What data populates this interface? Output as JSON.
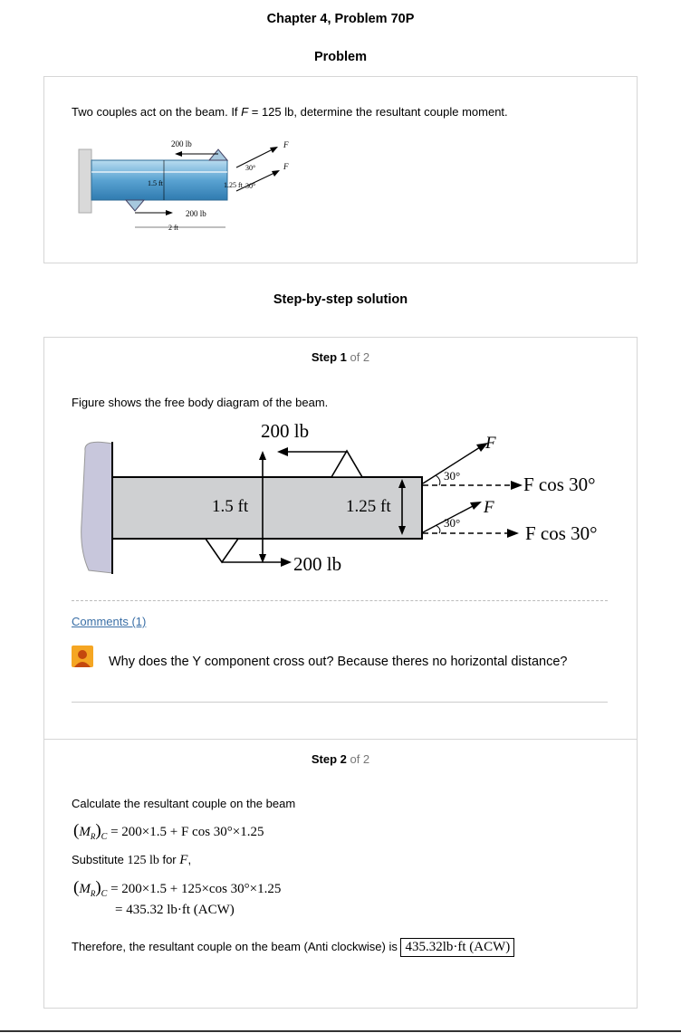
{
  "title": "Chapter 4, Problem 70P",
  "problem_heading": "Problem",
  "problem_text_before": "Two couples act on the beam. If ",
  "problem_var": "F",
  "problem_text_after": " = 125 lb, determine the resultant couple moment.",
  "problem_figure": {
    "force_top": "200 lb",
    "force_bottom": "200 lb",
    "dim_a": "1.5 ft",
    "dim_b": "1.25 ft",
    "dim_c": "2 ft",
    "angle_top": "30°",
    "angle_bottom": "30°",
    "force_f_top": "F",
    "force_f_bottom": "F"
  },
  "solution_heading": "Step-by-step solution",
  "step1": {
    "label": "Step 1",
    "of": " of 2",
    "text": "Figure shows the free body diagram of the beam.",
    "figure": {
      "force_top": "200 lb",
      "force_bottom": "200 lb",
      "dim_a": "1.5 ft",
      "dim_b": "1.25 ft",
      "angle_top": "30°",
      "angle_bottom": "30°",
      "f_top": "F",
      "f_mid": "F",
      "fcos_top": "F cos 30°",
      "fcos_bottom": "F cos 30°"
    }
  },
  "comments": {
    "link": "Comments (1)",
    "items": [
      {
        "text": "Why does the Y component cross out? Because theres no horizontal distance?"
      }
    ]
  },
  "step2": {
    "label": "Step 2",
    "of": " of 2",
    "text1": "Calculate the resultant couple on the beam",
    "eq1_rhs": "= 200×1.5 + F cos 30°×1.25",
    "substitute_word": "Substitute",
    "substitute_value": "125 lb",
    "substitute_for": "for",
    "substitute_var": "F",
    "substitute_comma": ",",
    "eq2_rhs": "= 200×1.5 + 125×cos 30°×1.25",
    "eq3": "= 435.32 lb·ft (ACW)",
    "final_text": "Therefore, the resultant couple on the beam (Anti clockwise) is",
    "final_answer": "435.32lb·ft (ACW)"
  },
  "colors": {
    "link": "#3a6fa6",
    "avatar": "#f5a623",
    "beam_fill": "#cfd0d2",
    "wall_fill": "#c8c7dc",
    "photo_beam": "#6aaed6"
  }
}
